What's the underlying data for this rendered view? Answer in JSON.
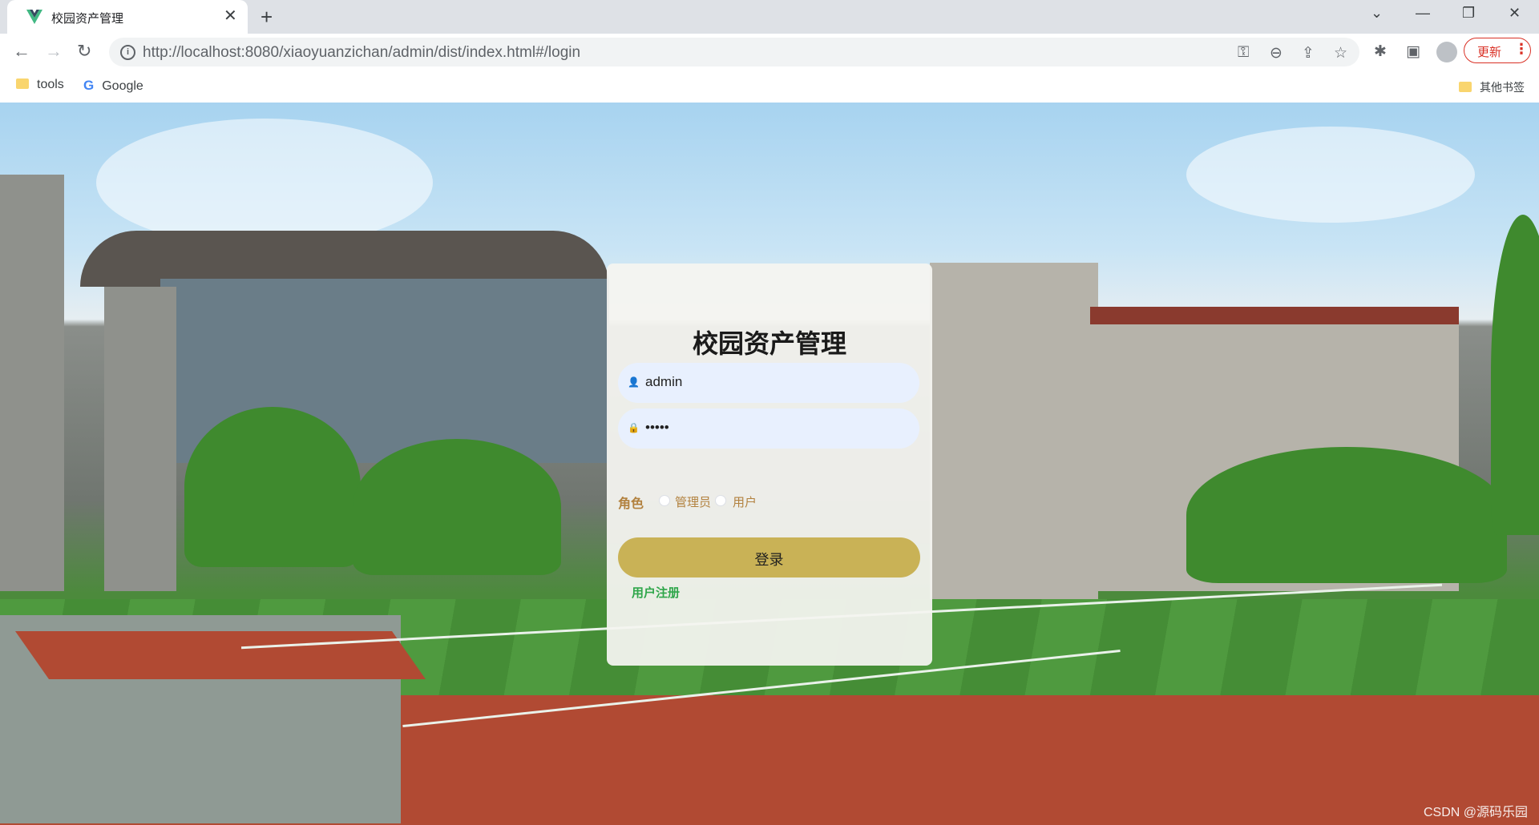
{
  "browser": {
    "tab": {
      "title": "校园资产管理"
    },
    "url": "http://localhost:8080/xiaoyuanzichan/admin/dist/index.html#/login",
    "update_label": "更新",
    "bookmarks": [
      {
        "label": "tools",
        "icon": "folder-icon"
      },
      {
        "label": "Google",
        "icon": "google-icon"
      }
    ],
    "other_bookmarks": "其他书签"
  },
  "login": {
    "title": "校园资产管理",
    "username": "admin",
    "password": "•••••",
    "role_label": "角色",
    "roles": [
      "管理员",
      "用户"
    ],
    "login_button": "登录",
    "register_link": "用户注册"
  },
  "watermark": "CSDN @源码乐园",
  "colors": {
    "accent_button": "#c9b256",
    "label_brown": "#b2813e",
    "link_green": "#2fa64a",
    "input_bg": "#e8f0fe"
  }
}
